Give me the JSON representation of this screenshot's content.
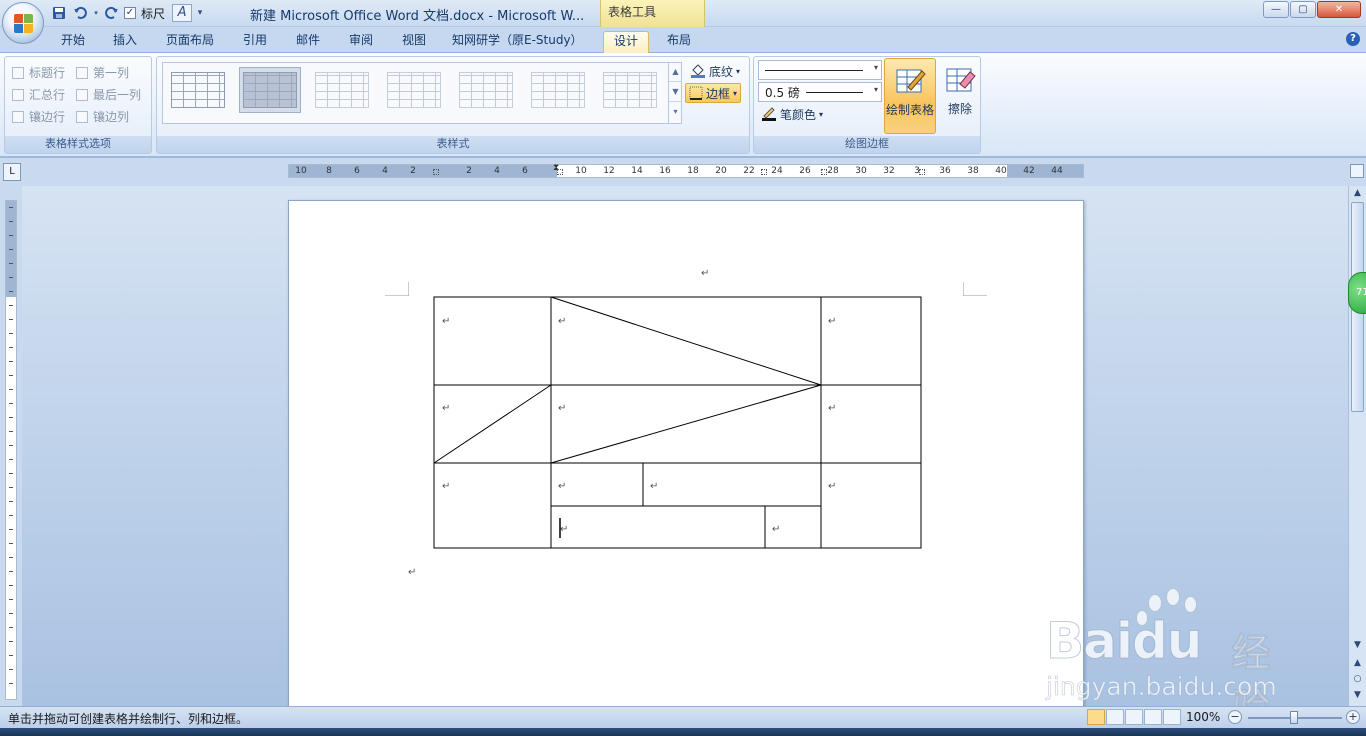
{
  "window": {
    "title": "新建 Microsoft Office Word 文档.docx - Microsoft W...",
    "context_tools_label": "表格工具",
    "controls": {
      "minimize": "—",
      "maximize": "▢",
      "close": "✕"
    }
  },
  "qat": {
    "ruler_label": "标尺",
    "ruler_checked": "✓",
    "save_icon": "save-icon",
    "undo_icon": "undo-icon",
    "redo_icon": "redo-icon"
  },
  "tabs": [
    {
      "label": "开始"
    },
    {
      "label": "插入"
    },
    {
      "label": "页面布局"
    },
    {
      "label": "引用"
    },
    {
      "label": "邮件"
    },
    {
      "label": "审阅"
    },
    {
      "label": "视图"
    },
    {
      "label": "知网研学（原E-Study）"
    },
    {
      "label": "设计",
      "active": true
    },
    {
      "label": "布局"
    }
  ],
  "ribbon": {
    "style_options": {
      "label": "表格样式选项",
      "items": [
        {
          "label": "标题行"
        },
        {
          "label": "第一列"
        },
        {
          "label": "汇总行"
        },
        {
          "label": "最后一列"
        },
        {
          "label": "镶边行"
        },
        {
          "label": "镶边列"
        }
      ]
    },
    "table_styles": {
      "label": "表样式",
      "shading_label": "底纹",
      "borders_label": "边框"
    },
    "draw_borders": {
      "label": "绘图边框",
      "weight_value": "0.5 磅",
      "pen_color_label": "笔颜色",
      "draw_table_label": "绘制表格",
      "eraser_label": "擦除"
    }
  },
  "ruler": {
    "ticks": [
      "10",
      "8",
      "6",
      "4",
      "2",
      "2",
      "4",
      "6",
      "10",
      "12",
      "14",
      "16",
      "18",
      "20",
      "22",
      "24",
      "26",
      "28",
      "30",
      "32",
      "3",
      "36",
      "38",
      "40",
      "42",
      "44"
    ]
  },
  "document": {
    "para_mark": "↵"
  },
  "status": {
    "text": "单击并拖动可创建表格并绘制行、列和边框。",
    "zoom": "100%"
  },
  "badge": {
    "text": "71"
  },
  "watermark": {
    "brand": "Bai",
    "brand2": "du",
    "cn": "经验",
    "url": "jingyan.baidu.com"
  },
  "colors": {
    "accent": "#f9c45c",
    "ribbon_bg": "#e6effa",
    "workspace": "#bfd2ea"
  }
}
